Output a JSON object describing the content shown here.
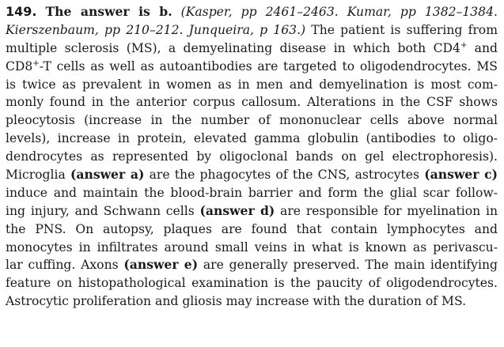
{
  "question_number": "149.",
  "answer_heading": "The answer is b.",
  "references": {
    "part1": "(Kasper, pp 2461–2463. Kumar, pp 1382–1384.",
    "part2": "Kierszenbaum, pp 210–212. Junqueira, p 163.)"
  },
  "lines": {
    "l1_tail": "The patient is suffering from",
    "l3_a": "multiple sclerosis (MS), a demyelinating disease in which both CD4",
    "l3_sup": "+",
    "l3_b": " and",
    "l4_a": "CD8",
    "l4_sup": "+",
    "l4_b": "-T cells as well as autoantibodies are targeted to oligodendrocytes. MS",
    "l5": "is twice as prevalent in women as in men and demyelination is most com-",
    "l6": "monly found in the anterior corpus callosum. Alterations in the CSF shows",
    "l7": "pleocytosis (increase in the number of mononuclear cells above normal",
    "l8": "levels), increase in protein, elevated gamma globulin (antibodies to oligo-",
    "l9": "dendrocytes as represented by oligoclonal bands on gel electrophoresis).",
    "l10_a": "Microglia ",
    "l10_ans": "(answer a)",
    "l10_b": " are the phagocytes of the CNS, astrocytes ",
    "l10_ans2": "(answer c)",
    "l11": "induce and maintain the blood-brain barrier and form the glial scar follow-",
    "l12_a": "ing injury, and Schwann cells ",
    "l12_ans": "(answer d)",
    "l12_b": " are responsible for myelination in",
    "l13": "the PNS. On autopsy, plaques are found that contain lymphocytes and",
    "l14": "monocytes in infiltrates around small veins in what is known as perivascu-",
    "l15_a": "lar cuffing. Axons ",
    "l15_ans": "(answer e)",
    "l15_b": " are generally preserved. The main identifying",
    "l16": "feature on histopathological examination is the paucity of oligodendrocytes.",
    "l17": "Astrocytic proliferation and gliosis may increase with the duration of MS."
  }
}
